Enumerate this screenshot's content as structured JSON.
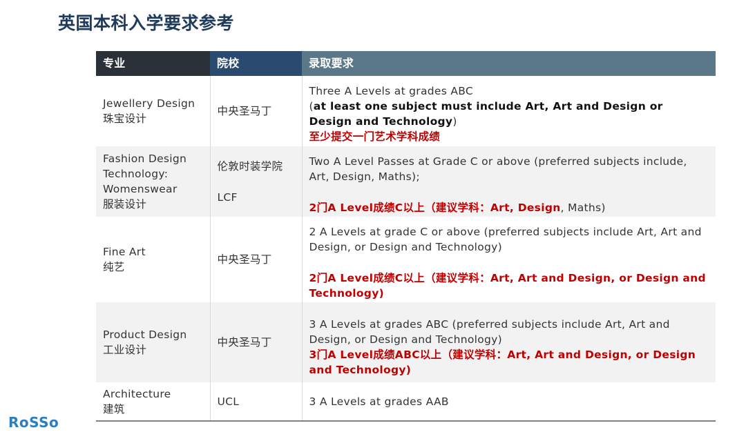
{
  "page": {
    "title": "英国本科入学要求参考"
  },
  "table": {
    "headers": {
      "major": "专业",
      "school": "院校",
      "requirement": "录取要求"
    },
    "rows": [
      {
        "major_en": "Jewellery Design",
        "major_cn": "珠宝设计",
        "school": "中央圣马丁",
        "req_line1": "Three A Levels at grades ABC",
        "req_open_paren": "(",
        "req_bold": "at least one subject must include Art, Art and Design or Design and Technology",
        "req_close_paren": ")",
        "req_cn": "至少提交一门艺术学科成绩"
      },
      {
        "major_en": "Fashion Design Technology: Womenswear",
        "major_cn": "服装设计",
        "school": "伦敦时装学院",
        "school_abbr": "LCF",
        "req_en": "Two A Level Passes at Grade C or above (preferred subjects include, Art, Design, Maths);",
        "req_cn_bold": "2门A Level成绩C以上（建议学科：Art, Design",
        "req_cn_tail": ", Maths)"
      },
      {
        "major_en": "Fine Art",
        "major_cn": "纯艺",
        "school": "中央圣马丁",
        "req_en": "2 A Levels at grade C or above (preferred subjects include Art, Art and Design, or Design and Technology)",
        "req_cn": "2门A Level成绩C以上（建议学科：Art, Art and Design, or Design and Technology)"
      },
      {
        "major_en": "Product Design",
        "major_cn": "工业设计",
        "school": "中央圣马丁",
        "req_en": "3 A Levels at grades ABC (preferred subjects include Art, Art and Design, or Design and Technology)",
        "req_cn": "3门A Level成绩ABC以上（建议学科：Art, Art and Design, or Design and Technology)"
      },
      {
        "major_en": "Architecture",
        "major_cn": "建筑",
        "school": "UCL",
        "req_en": "3 A Levels at grades AAB"
      }
    ]
  },
  "logo": {
    "text": "RoSSo"
  },
  "colors": {
    "title": "#1f3a5a",
    "header_major": "#2a3138",
    "header_school": "#2b4a70",
    "header_requirement": "#5b7888",
    "highlight_red": "#c00000",
    "logo": "#2b7fc1"
  }
}
